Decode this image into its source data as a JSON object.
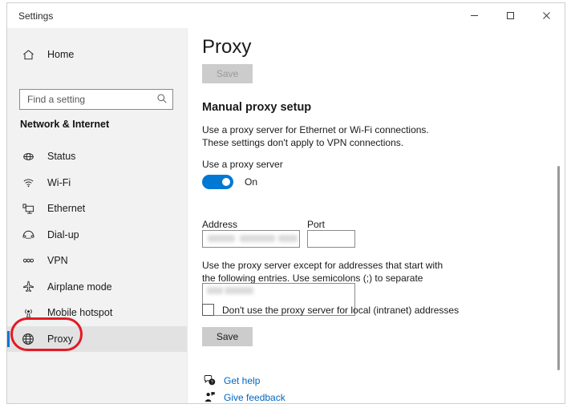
{
  "window": {
    "title": "Settings",
    "controls": {
      "minimize": "minimize",
      "maximize": "maximize",
      "close": "close"
    }
  },
  "sidebar": {
    "home_label": "Home",
    "home_icon": "home-icon",
    "search": {
      "placeholder": "Find a setting",
      "value": "",
      "icon": "search-icon"
    },
    "section_title": "Network & Internet",
    "items": [
      {
        "label": "Status",
        "icon": "network-status-icon",
        "selected": false
      },
      {
        "label": "Wi-Fi",
        "icon": "wifi-icon",
        "selected": false
      },
      {
        "label": "Ethernet",
        "icon": "ethernet-icon",
        "selected": false
      },
      {
        "label": "Dial-up",
        "icon": "dialup-phone-icon",
        "selected": false
      },
      {
        "label": "VPN",
        "icon": "vpn-icon",
        "selected": false
      },
      {
        "label": "Airplane mode",
        "icon": "airplane-icon",
        "selected": false
      },
      {
        "label": "Mobile hotspot",
        "icon": "hotspot-icon",
        "selected": false
      },
      {
        "label": "Proxy",
        "icon": "globe-icon",
        "selected": true
      }
    ]
  },
  "annotation": {
    "shape": "red-ellipse-highlight",
    "target": "Proxy",
    "color": "#e01b24"
  },
  "main": {
    "page_title": "Proxy",
    "save_top_label": "Save",
    "save_top_disabled": true,
    "section_heading": "Manual proxy setup",
    "description": "Use a proxy server for Ethernet or Wi-Fi connections. These settings don't apply to VPN connections.",
    "use_proxy_label": "Use a proxy server",
    "toggle_state": "On",
    "toggle_on": true,
    "toggle_color": "#0078d4",
    "address_label": "Address",
    "address_value": "",
    "address_redacted": true,
    "port_label": "Port",
    "port_value": "",
    "exceptions_description": "Use the proxy server except for addresses that start with the following entries. Use semicolons (;) to separate entries.",
    "exceptions_value": "",
    "exceptions_redacted": true,
    "bypass_local_label": "Don't use the proxy server for local (intranet) addresses",
    "bypass_local_checked": false,
    "save_bottom_label": "Save",
    "links": [
      {
        "label": "Get help",
        "icon": "help-question-icon"
      },
      {
        "label": "Give feedback",
        "icon": "feedback-person-icon"
      }
    ]
  }
}
